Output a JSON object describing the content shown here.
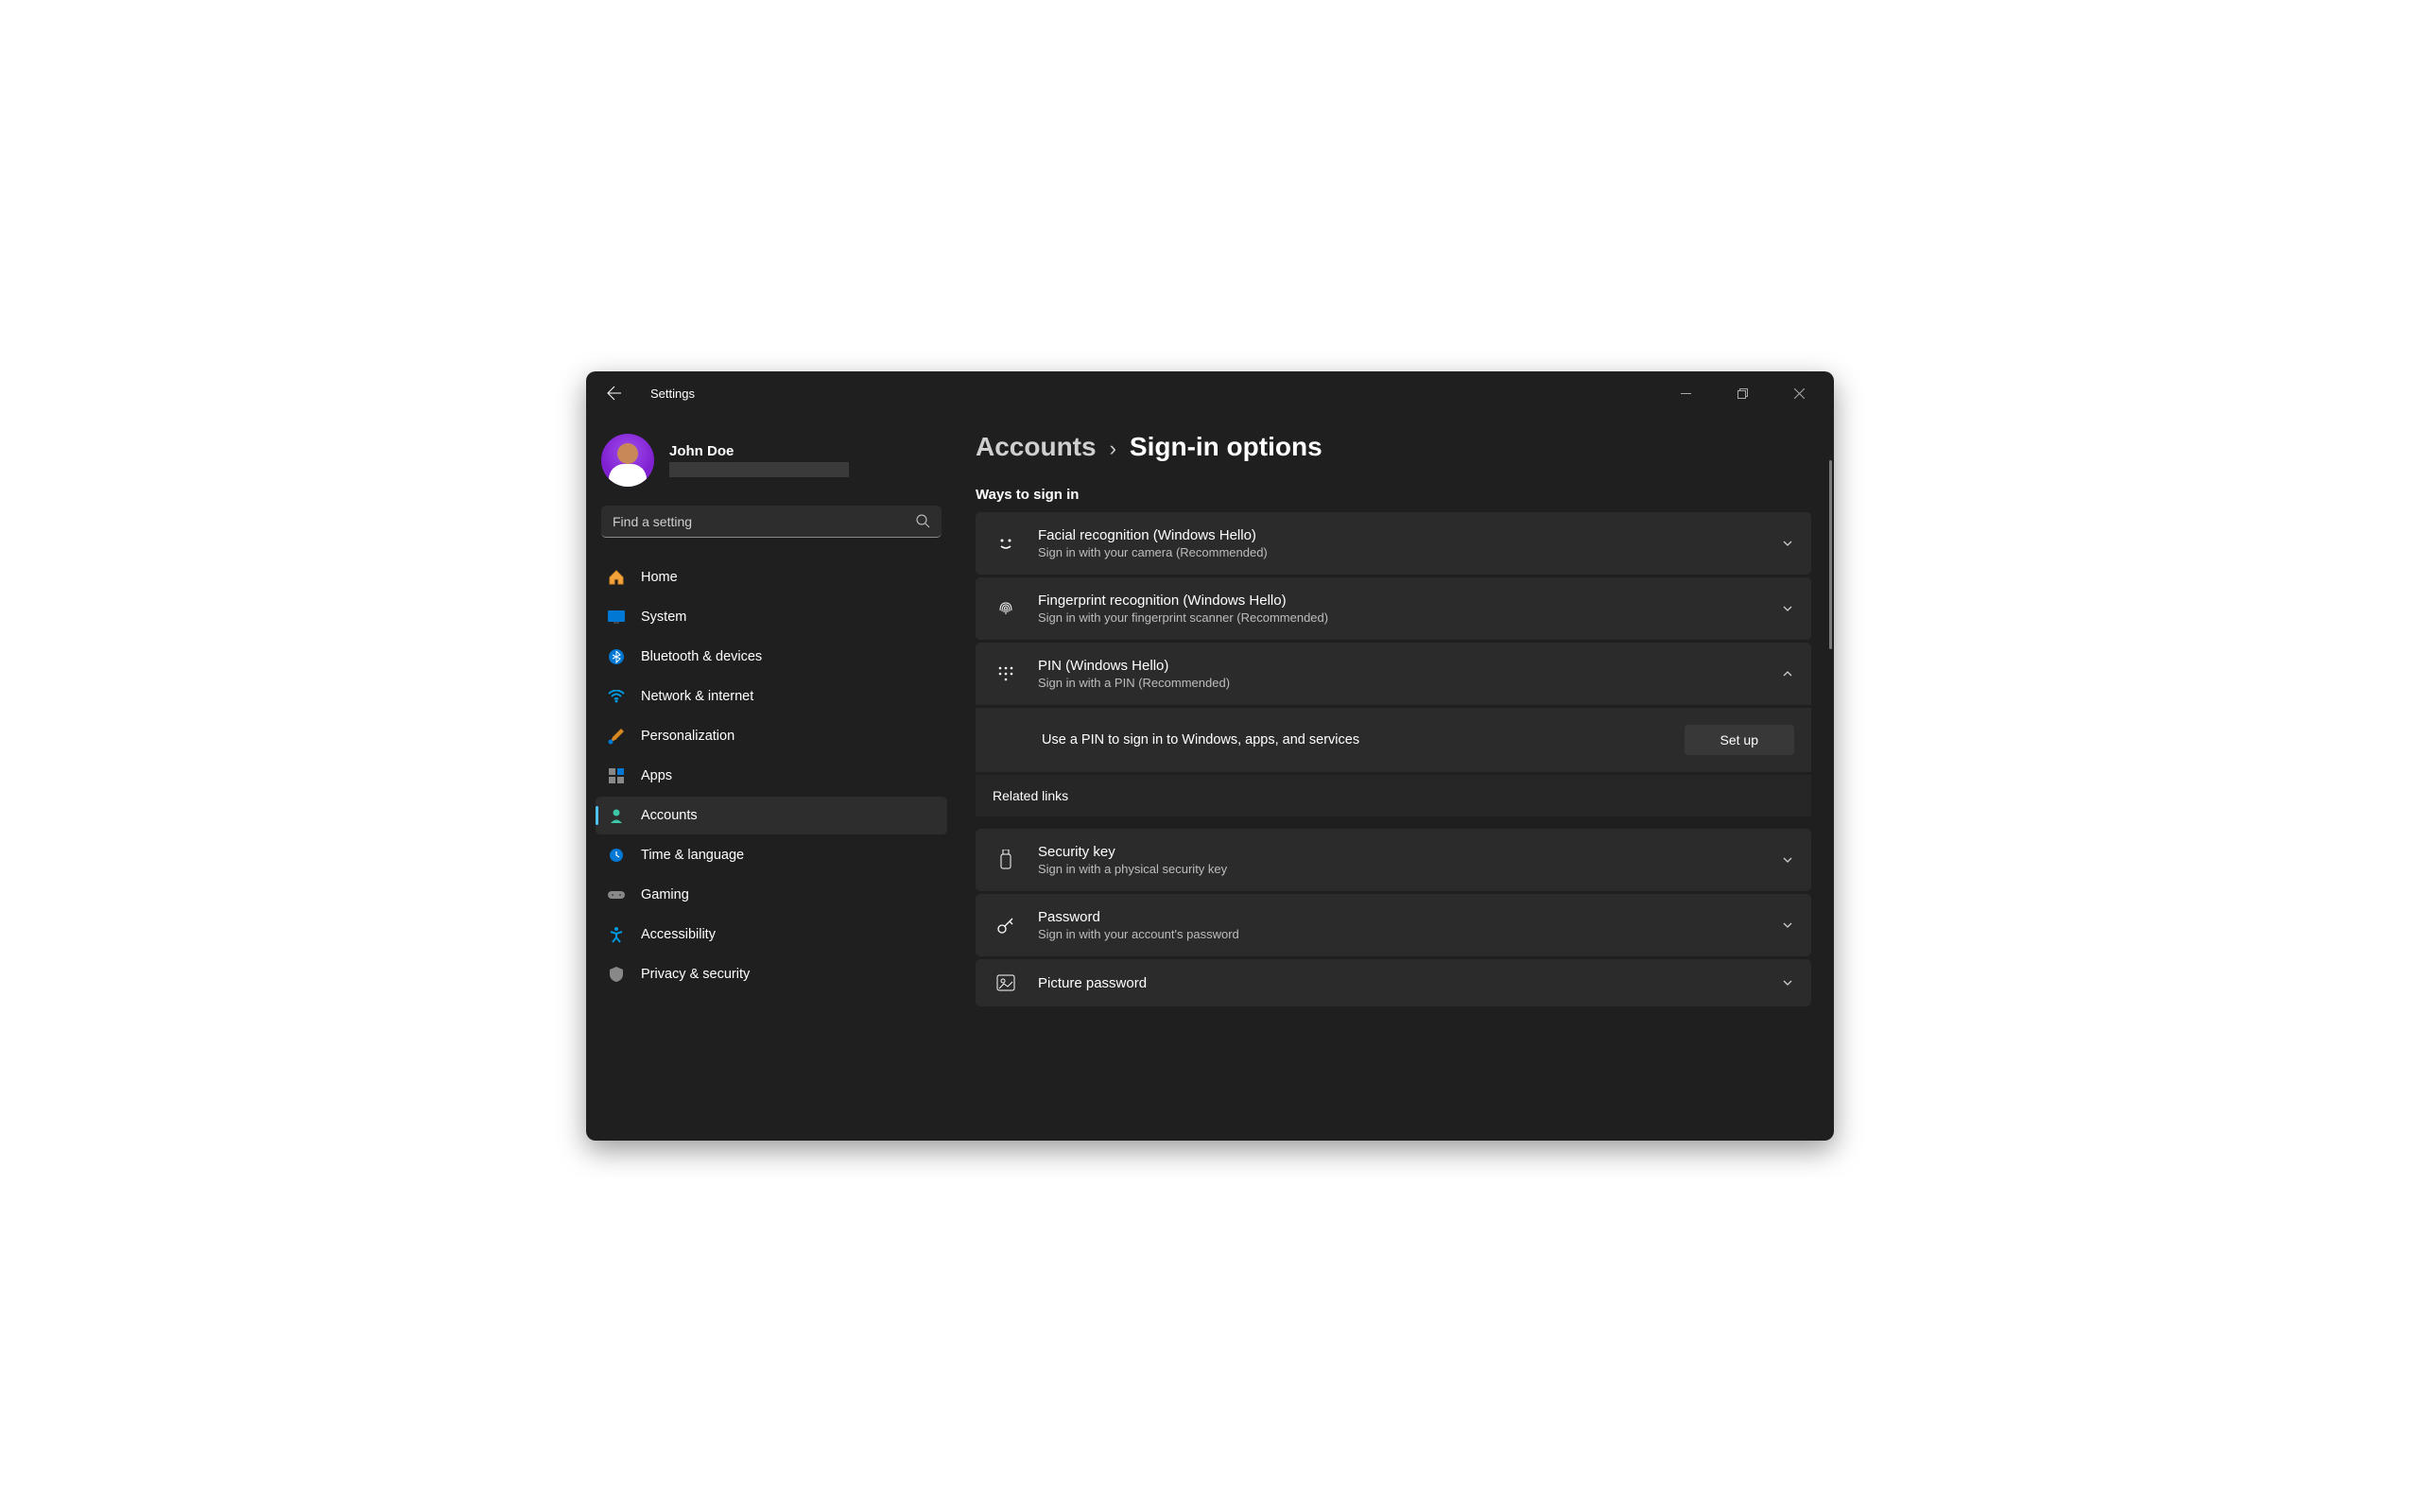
{
  "app": {
    "title": "Settings"
  },
  "user": {
    "name": "John Doe"
  },
  "search": {
    "placeholder": "Find a setting"
  },
  "sidebar": [
    {
      "label": "Home"
    },
    {
      "label": "System"
    },
    {
      "label": "Bluetooth & devices"
    },
    {
      "label": "Network & internet"
    },
    {
      "label": "Personalization"
    },
    {
      "label": "Apps"
    },
    {
      "label": "Accounts"
    },
    {
      "label": "Time & language"
    },
    {
      "label": "Gaming"
    },
    {
      "label": "Accessibility"
    },
    {
      "label": "Privacy & security"
    }
  ],
  "breadcrumb": {
    "parent": "Accounts",
    "current": "Sign-in options"
  },
  "section_title": "Ways to sign in",
  "cards": {
    "face": {
      "title": "Facial recognition (Windows Hello)",
      "sub": "Sign in with your camera (Recommended)"
    },
    "finger": {
      "title": "Fingerprint recognition (Windows Hello)",
      "sub": "Sign in with your fingerprint scanner (Recommended)"
    },
    "pin": {
      "title": "PIN (Windows Hello)",
      "sub": "Sign in with a PIN (Recommended)"
    },
    "pin_detail": {
      "text": "Use a PIN to sign in to Windows, apps, and services",
      "button": "Set up"
    },
    "related": "Related links",
    "seckey": {
      "title": "Security key",
      "sub": "Sign in with a physical security key"
    },
    "password": {
      "title": "Password",
      "sub": "Sign in with your account's password"
    },
    "picture": {
      "title": "Picture password"
    }
  }
}
